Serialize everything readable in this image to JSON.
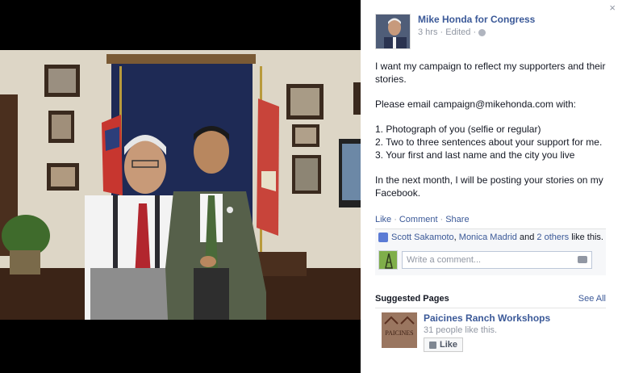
{
  "panel": {
    "close_label": "×",
    "page_name": "Mike Honda for Congress",
    "meta": "3 hrs · Edited ·",
    "post_paragraphs": [
      "I want my campaign to reflect my supporters and their stories.",
      "Please email campaign@mikehonda.com with:",
      "1. Photograph of you (selfie or regular)\n2. Two to three sentences about your support for me.\n3. Your first and last name and the city you live",
      "In the next month, I will be posting your stories on my Facebook."
    ],
    "actions": {
      "like": "Like",
      "comment": "Comment",
      "share": "Share",
      "sep": "·"
    },
    "likes": {
      "name1": "Scott Sakamoto",
      "sep1": ",",
      "name2": "Monica Madrid",
      "and": "and",
      "others": "2 others",
      "suffix": "like this."
    },
    "comment_placeholder": "Write a comment...",
    "suggested": {
      "title": "Suggested Pages",
      "see_all": "See All",
      "page_name": "Paicines Ranch Workshops",
      "count": "31 people like this.",
      "like_button": "Like",
      "thumb_text": "PAICINES"
    }
  }
}
